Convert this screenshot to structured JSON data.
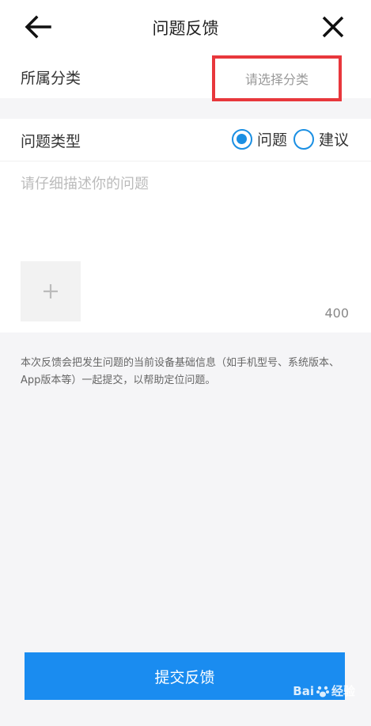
{
  "header": {
    "title": "问题反馈",
    "back_icon": "arrow-left-icon",
    "close_icon": "close-icon"
  },
  "category": {
    "label": "所属分类",
    "placeholder": "请选择分类",
    "highlight_color": "#e8373c"
  },
  "type": {
    "label": "问题类型",
    "options": [
      {
        "label": "问题",
        "selected": true
      },
      {
        "label": "建议",
        "selected": false
      }
    ],
    "accent_color": "#1a8fe3"
  },
  "description": {
    "placeholder": "请仔细描述你的问题",
    "value": "",
    "counter": "400"
  },
  "upload": {
    "icon": "plus-icon"
  },
  "notice": "本次反馈会把发生问题的当前设备基础信息（如手机型号、系统版本、App版本等）一起提交，以帮助定位问题。",
  "submit": {
    "label": "提交反馈",
    "color": "#1a8cf0"
  },
  "watermark": {
    "text": "经验",
    "logo": "Bai"
  }
}
